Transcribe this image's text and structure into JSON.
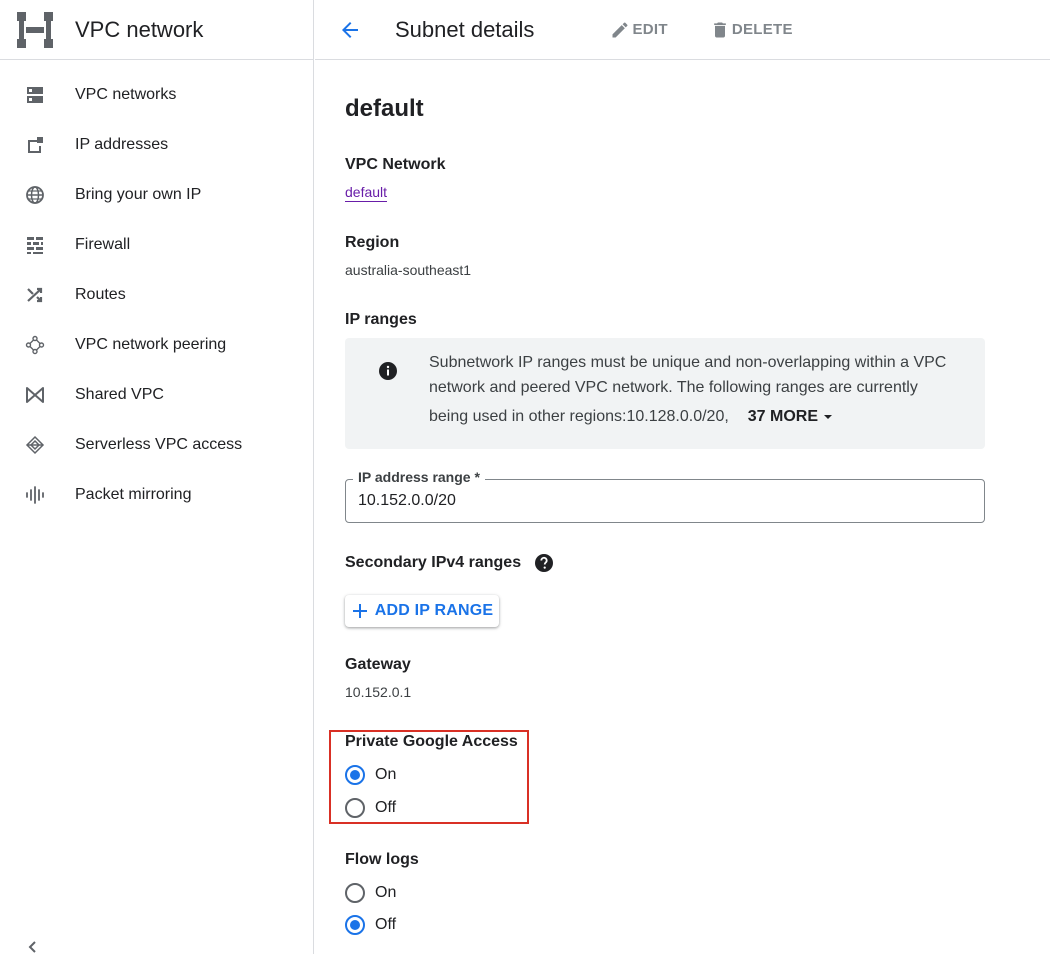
{
  "sidebar": {
    "title": "VPC network",
    "items": [
      {
        "label": "VPC networks",
        "icon": "vpc-networks-icon"
      },
      {
        "label": "IP addresses",
        "icon": "ip-addresses-icon"
      },
      {
        "label": "Bring your own IP",
        "icon": "globe-icon"
      },
      {
        "label": "Firewall",
        "icon": "firewall-icon"
      },
      {
        "label": "Routes",
        "icon": "routes-icon"
      },
      {
        "label": "VPC network peering",
        "icon": "peering-icon"
      },
      {
        "label": "Shared VPC",
        "icon": "shared-vpc-icon"
      },
      {
        "label": "Serverless VPC access",
        "icon": "serverless-icon"
      },
      {
        "label": "Packet mirroring",
        "icon": "packet-mirroring-icon"
      }
    ]
  },
  "toolbar": {
    "title": "Subnet details",
    "edit_label": "EDIT",
    "delete_label": "DELETE"
  },
  "subnet": {
    "name": "default",
    "vpc_network_label": "VPC Network",
    "vpc_network_value": "default",
    "region_label": "Region",
    "region_value": "australia-southeast1",
    "ip_ranges_label": "IP ranges",
    "info_line1": "Subnetwork IP ranges must be unique and non-overlapping within a VPC",
    "info_line2": "network and peered VPC network. The following ranges are currently",
    "info_line3": "being used in other regions:10.128.0.0/20,",
    "more_label": "37 MORE",
    "ip_range_field_label": "IP address range *",
    "ip_range_value": "10.152.0.0/20",
    "secondary_label": "Secondary IPv4 ranges",
    "add_range_label": "ADD IP RANGE",
    "gateway_label": "Gateway",
    "gateway_value": "10.152.0.1",
    "pga_label": "Private Google Access",
    "pga_on": "On",
    "pga_off": "Off",
    "pga_selected": "On",
    "flow_label": "Flow logs",
    "flow_on": "On",
    "flow_off": "Off",
    "flow_selected": "Off"
  },
  "colors": {
    "accent": "#1a73e8",
    "link": "#681da8",
    "highlight": "#d93025"
  }
}
